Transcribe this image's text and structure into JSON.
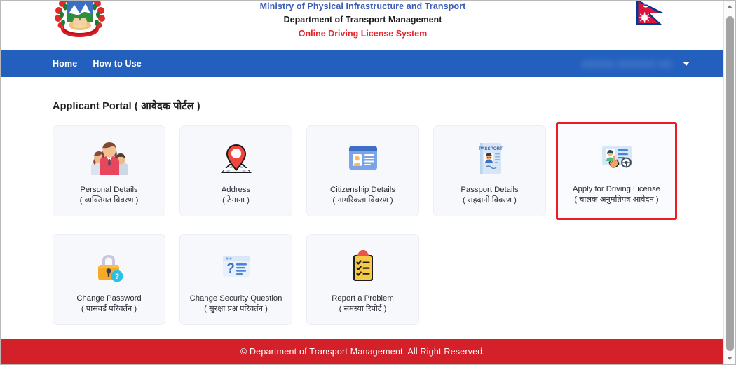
{
  "header": {
    "emblem_icon": "nepal-emblem-icon",
    "flag_icon": "nepal-flag-icon",
    "ministry_line": "Ministry of Physical Infrastructure and Transport",
    "department_line": "Department of Transport Management",
    "system_line": "Online Driving License System",
    "colors": {
      "ministry": "#3b5bb5",
      "department": "#1c1c1c",
      "system": "#e8242a"
    }
  },
  "navbar": {
    "background": "#2360be",
    "links": [
      {
        "label": "Home"
      },
      {
        "label": "How to Use"
      }
    ],
    "user_menu": {
      "label": "",
      "redacted": true,
      "caret_icon": "chevron-down-icon"
    }
  },
  "main": {
    "portal_title": "Applicant Portal ( आवेदक पोर्टल )",
    "cards": [
      {
        "en": "Personal Details",
        "np": "( व्यक्तिगत विवरण )",
        "icon": "family-group-icon",
        "highlighted": false
      },
      {
        "en": "Address",
        "np": "( ठेगाना )",
        "icon": "map-pin-icon",
        "highlighted": false
      },
      {
        "en": "Citizenship Details",
        "np": "( नागरिकता विवरण )",
        "icon": "id-card-icon",
        "highlighted": false
      },
      {
        "en": "Passport Details",
        "np": "( राहदानी विवरण )",
        "icon": "passport-icon",
        "highlighted": false
      },
      {
        "en": "Apply for Driving License",
        "np": "( चालक अनुमतिपत्र आवेदन )",
        "icon": "driving-license-apply-icon",
        "highlighted": true,
        "highlight_color": "#ec1c24"
      },
      {
        "en": "Change Password",
        "np": "( पासवर्ड परिवर्तन )",
        "icon": "padlock-help-icon",
        "highlighted": false
      },
      {
        "en": "Change Security Question",
        "np": "( सुरक्षा प्रश्न परिवर्तन )",
        "icon": "question-window-icon",
        "highlighted": false
      },
      {
        "en": "Report a Problem",
        "np": "( समस्या रिपोर्ट )",
        "icon": "clipboard-checklist-icon",
        "highlighted": false
      }
    ]
  },
  "footer": {
    "text": "© Department of Transport Management. All Right Reserved.",
    "background": "#d32029"
  },
  "scrollbar": {
    "up_icon": "scroll-up-arrow-icon",
    "down_icon": "scroll-down-arrow-icon"
  }
}
